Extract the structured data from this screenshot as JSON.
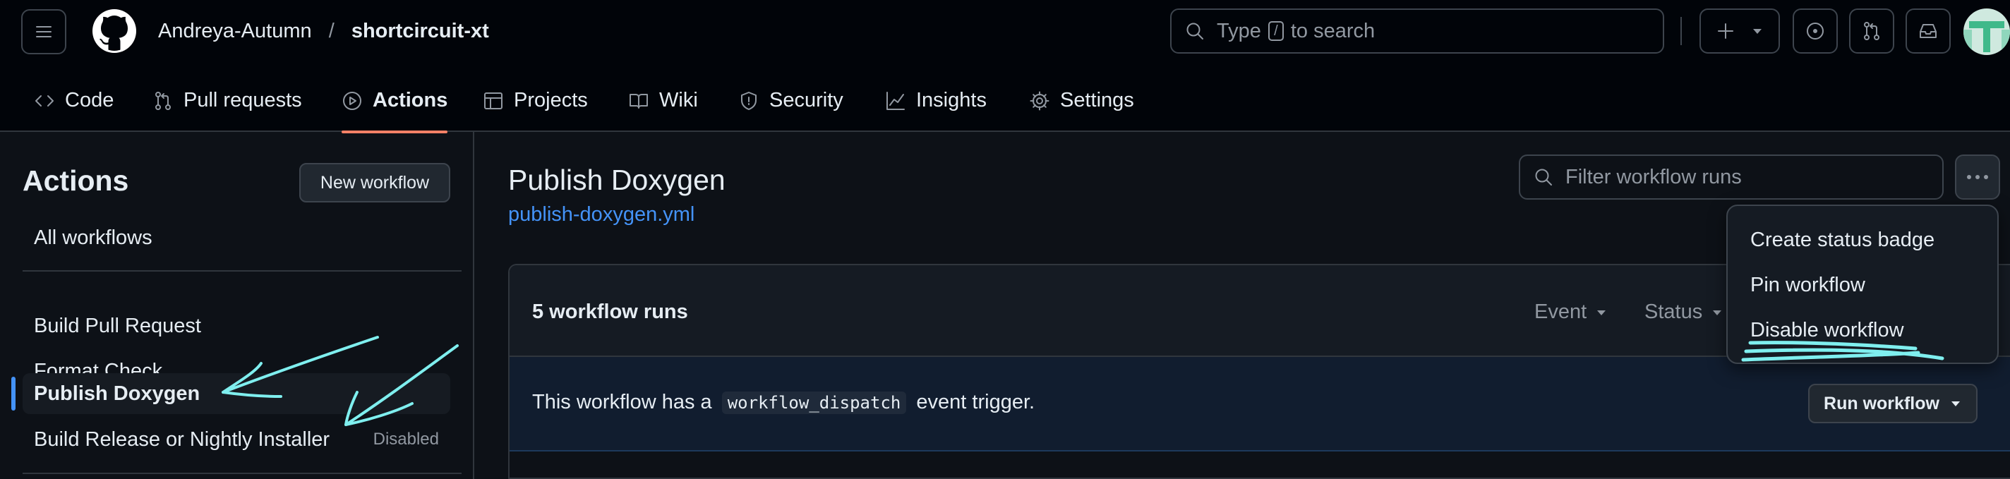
{
  "header": {
    "owner": "Andreya-Autumn",
    "separator": "/",
    "repo": "shortcircuit-xt",
    "search_prefix": "Type",
    "search_key": "/",
    "search_suffix": "to search",
    "icons": [
      "hamburger-icon",
      "github-logo",
      "search-icon",
      "plus-icon",
      "caret-down-icon",
      "issue-icon",
      "pull-request-icon",
      "inbox-icon"
    ]
  },
  "repo_nav": {
    "tabs": [
      {
        "label": "Code",
        "icon": "code-icon"
      },
      {
        "label": "Pull requests",
        "icon": "pull-request-icon"
      },
      {
        "label": "Actions",
        "icon": "play-icon",
        "active": true
      },
      {
        "label": "Projects",
        "icon": "table-icon"
      },
      {
        "label": "Wiki",
        "icon": "book-icon"
      },
      {
        "label": "Security",
        "icon": "shield-icon"
      },
      {
        "label": "Insights",
        "icon": "graph-icon"
      },
      {
        "label": "Settings",
        "icon": "gear-icon"
      }
    ]
  },
  "sidebar": {
    "title": "Actions",
    "new_workflow": "New workflow",
    "all_workflows": "All workflows",
    "workflows": [
      {
        "label": "Build Pull Request"
      },
      {
        "label": "Format Check"
      },
      {
        "label": "Publish Doxygen",
        "selected": true
      },
      {
        "label": "Build Release or Nightly Installer",
        "badge": "Disabled"
      }
    ]
  },
  "main": {
    "title": "Publish Doxygen",
    "file": "publish-doxygen.yml",
    "filter_placeholder": "Filter workflow runs",
    "runs_count": "5 workflow runs",
    "event_filter": "Event",
    "status_filter": "Status",
    "dispatch_prefix": "This workflow has a",
    "dispatch_code": "workflow_dispatch",
    "dispatch_suffix": "event trigger.",
    "run_workflow": "Run workflow"
  },
  "menu": {
    "items": [
      "Create status badge",
      "Pin workflow",
      "Disable workflow"
    ]
  },
  "colors": {
    "background": "#0d1117",
    "header": "#010409",
    "accent_underline": "#f78166",
    "link": "#4493f8",
    "annotation": "#7fefef"
  }
}
